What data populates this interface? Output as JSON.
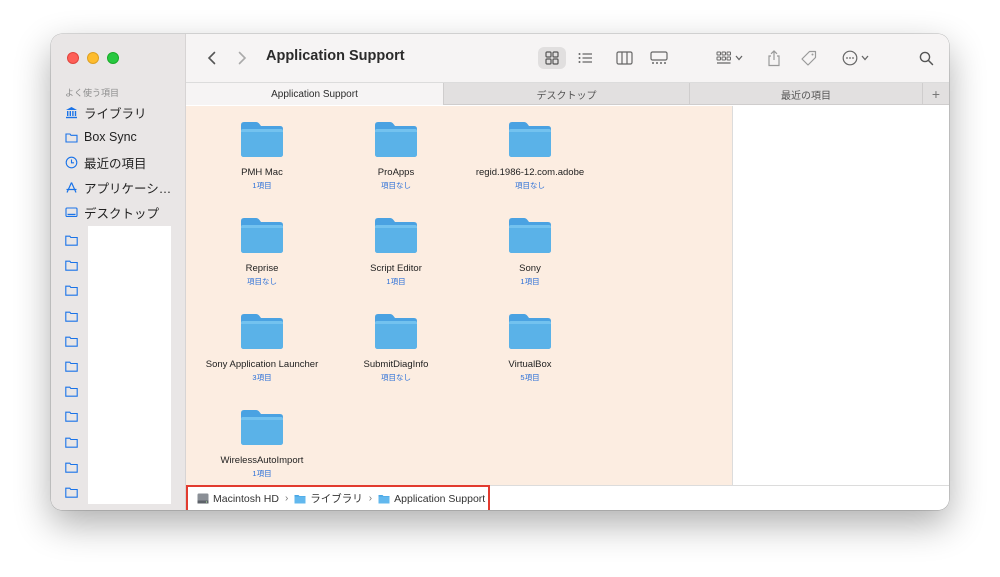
{
  "window": {
    "toolbar": {
      "title": "Application Support",
      "buttons": [
        "back",
        "forward",
        "icon-view",
        "list-view",
        "column-view",
        "gallery-view",
        "group",
        "share",
        "tag",
        "more",
        "search"
      ]
    },
    "sidebar": {
      "heading": "よく使う項目",
      "items": [
        {
          "label": "ライブラリ",
          "icon": "library-icon"
        },
        {
          "label": "Box Sync",
          "icon": "folder-icon"
        },
        {
          "label": "最近の項目",
          "icon": "clock-icon"
        },
        {
          "label": "アプリケーシ…",
          "icon": "apps-icon"
        },
        {
          "label": "デスクトップ",
          "icon": "desktop-icon"
        }
      ]
    },
    "tabs": [
      {
        "label": "Application Support",
        "active": true
      },
      {
        "label": "デスクトップ",
        "active": false
      },
      {
        "label": "最近の項目",
        "active": false
      }
    ],
    "tab_add": "+",
    "folders": [
      {
        "name": "PMH Mac",
        "count": "1項目"
      },
      {
        "name": "ProApps",
        "count": "項目なし"
      },
      {
        "name": "regid.1986-12.com.adobe",
        "count": "項目なし"
      },
      {
        "name": "Reprise",
        "count": "項目なし"
      },
      {
        "name": "Script Editor",
        "count": "1項目"
      },
      {
        "name": "Sony",
        "count": "1項目"
      },
      {
        "name": "Sony Application Launcher",
        "count": "3項目"
      },
      {
        "name": "SubmitDiagInfo",
        "count": "項目なし"
      },
      {
        "name": "VirtualBox",
        "count": "5項目"
      },
      {
        "name": "WirelessAutoImport",
        "count": "1項目"
      }
    ],
    "pathbar": {
      "segments": [
        "Macintosh HD",
        "ライブラリ",
        "Application Support"
      ],
      "separator": "›"
    }
  },
  "colors": {
    "accent": "#1a73e8",
    "folder": "#5ab2e8",
    "content_bg": "#fcede1",
    "highlight_border": "#e23b2f"
  }
}
